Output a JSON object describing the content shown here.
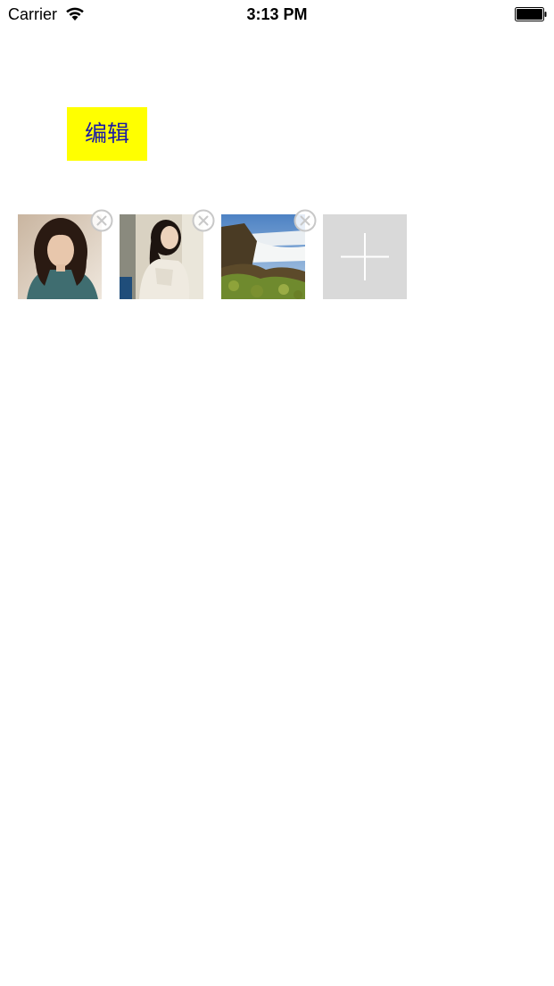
{
  "status_bar": {
    "carrier": "Carrier",
    "time": "3:13 PM",
    "icons": [
      "wifi-icon",
      "battery-icon"
    ]
  },
  "edit_button": {
    "label": "编辑",
    "background": "#ffff00",
    "text_color": "#1a1aa6"
  },
  "photos": [
    {
      "subject": "woman-portrait",
      "deletable": true
    },
    {
      "subject": "woman-by-window",
      "deletable": true
    },
    {
      "subject": "waterfall-landscape",
      "deletable": true
    }
  ],
  "add_photo": {
    "icon": "plus-icon",
    "background": "#d9d9d9"
  },
  "delete_icon": "close-circle-icon"
}
